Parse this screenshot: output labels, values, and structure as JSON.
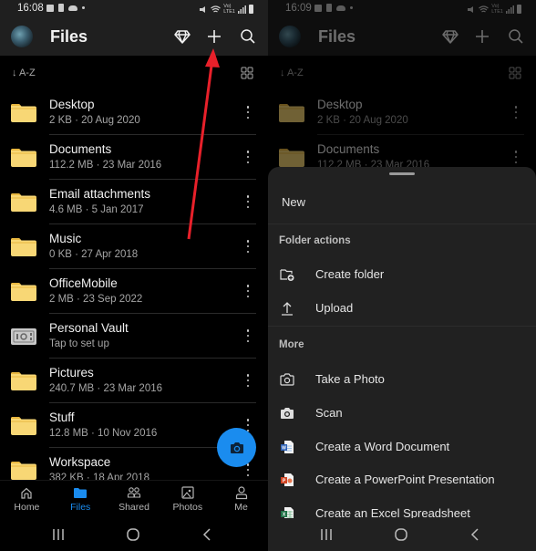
{
  "left": {
    "status": {
      "time": "16:08"
    },
    "appbar": {
      "title": "Files"
    },
    "sort": {
      "label": "↓ A-Z"
    },
    "files": [
      {
        "name": "Desktop",
        "meta": "2 KB · 20 Aug 2020",
        "icon": "folder-icon"
      },
      {
        "name": "Documents",
        "meta": "112.2 MB · 23 Mar 2016",
        "icon": "folder-icon"
      },
      {
        "name": "Email attachments",
        "meta": "4.6 MB · 5 Jan 2017",
        "icon": "folder-icon"
      },
      {
        "name": "Music",
        "meta": "0 KB · 27 Apr 2018",
        "icon": "folder-icon"
      },
      {
        "name": "OfficeMobile",
        "meta": "2 MB · 23 Sep 2022",
        "icon": "folder-icon"
      },
      {
        "name": "Personal Vault",
        "meta": "Tap to set up",
        "icon": "vault-icon"
      },
      {
        "name": "Pictures",
        "meta": "240.7 MB · 23 Mar 2016",
        "icon": "folder-icon"
      },
      {
        "name": "Stuff",
        "meta": "12.8 MB · 10 Nov 2016",
        "icon": "folder-icon"
      },
      {
        "name": "Workspace",
        "meta": "382 KB · 18 Apr 2018",
        "icon": "folder-icon"
      }
    ],
    "nav": [
      {
        "label": "Home",
        "icon": "home-icon",
        "active": false
      },
      {
        "label": "Files",
        "icon": "folder-icon",
        "active": true
      },
      {
        "label": "Shared",
        "icon": "shared-icon",
        "active": false
      },
      {
        "label": "Photos",
        "icon": "photos-icon",
        "active": false
      },
      {
        "label": "Me",
        "icon": "person-icon",
        "active": false
      }
    ]
  },
  "right": {
    "status": {
      "time": "16:09"
    },
    "appbar": {
      "title": "Files"
    },
    "sort": {
      "label": "↓ A-Z"
    },
    "files": [
      {
        "name": "Desktop",
        "meta": "2 KB · 20 Aug 2020"
      },
      {
        "name": "Documents",
        "meta": "112.2 MB · 23 Mar 2016"
      }
    ],
    "sheet": {
      "title": "New",
      "sections": [
        {
          "heading": "Folder actions",
          "items": [
            {
              "label": "Create folder",
              "icon": "create-folder-icon"
            },
            {
              "label": "Upload",
              "icon": "upload-icon"
            }
          ]
        },
        {
          "heading": "More",
          "items": [
            {
              "label": "Take a Photo",
              "icon": "camera-outline-icon"
            },
            {
              "label": "Scan",
              "icon": "scan-camera-icon"
            },
            {
              "label": "Create a Word Document",
              "icon": "word-icon"
            },
            {
              "label": "Create a PowerPoint Presentation",
              "icon": "powerpoint-icon"
            },
            {
              "label": "Create an Excel Spreadsheet",
              "icon": "excel-icon"
            }
          ]
        }
      ]
    }
  },
  "colors": {
    "accent": "#1a8cef",
    "folder": "#f8d775",
    "annotation_arrow": "#e8202a",
    "sheet_bg": "#212121",
    "appbar_bg": "#1f1f1f"
  }
}
